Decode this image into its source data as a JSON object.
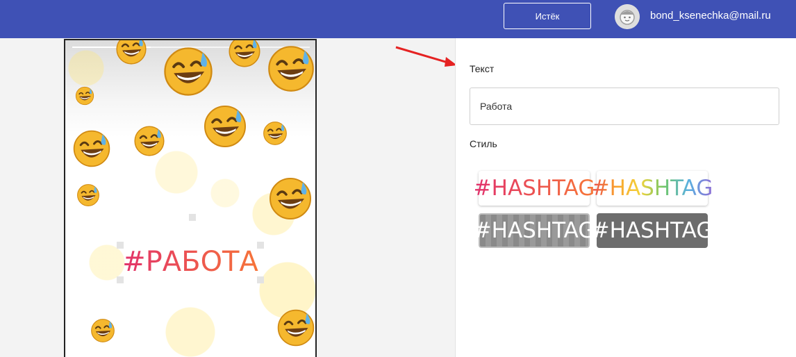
{
  "header": {
    "expire_button": "Истёк",
    "user_email": "bond_ksenechka@mail.ru",
    "avatar_icon": "user-avatar-icon"
  },
  "editor": {
    "text_label": "Текст",
    "text_value": "Работа",
    "style_label": "Стиль",
    "style_options": [
      {
        "label": "#HASHTAG",
        "style": "pink-orange-gradient"
      },
      {
        "label": "#HASHTAG",
        "style": "rainbow-gradient"
      },
      {
        "label": "#HASHTAG",
        "style": "white-on-transparent"
      },
      {
        "label": "#HASHTAG",
        "style": "white-on-gray"
      }
    ]
  },
  "preview": {
    "hashtag": "#РАБОТА",
    "progress": 0.33,
    "background_icon": "sweat-smile-emoji-icon"
  },
  "colors": {
    "header_bg": "#3f51b5",
    "emoji_yellow": "#f5b82e",
    "annotation_arrow": "#e52222"
  }
}
